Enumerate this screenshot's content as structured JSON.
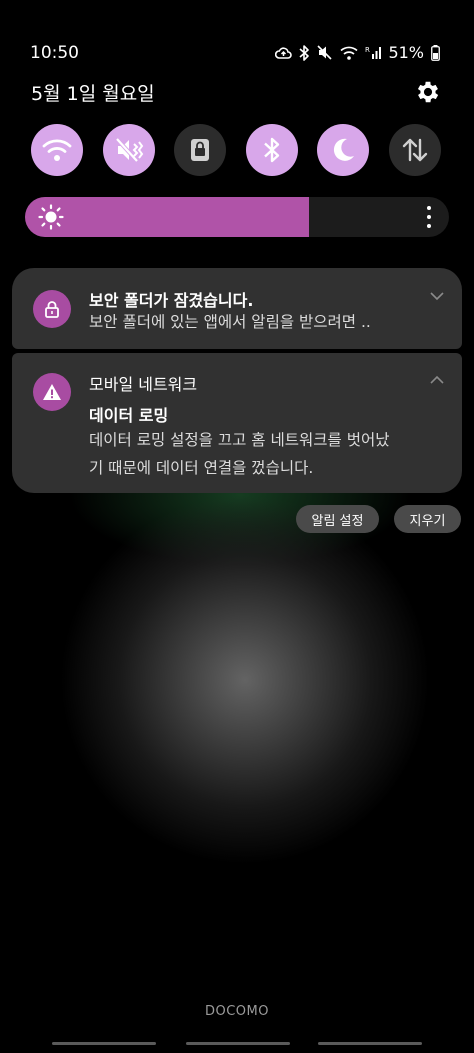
{
  "status_bar": {
    "time": "10:50",
    "battery": "51%",
    "icons": [
      "cloud-upload-icon",
      "bluetooth-icon",
      "mute-icon",
      "wifi-icon",
      "roaming-signal-icon",
      "battery-icon"
    ]
  },
  "header": {
    "date": "5월 1일 월요일",
    "settings_icon": "gear-icon"
  },
  "quick_settings": [
    {
      "name": "wifi",
      "icon": "wifi-icon",
      "state": "on"
    },
    {
      "name": "mute",
      "icon": "mute-vibrate-icon",
      "state": "on"
    },
    {
      "name": "secure-folder",
      "icon": "lock-icon",
      "state": "off"
    },
    {
      "name": "bluetooth",
      "icon": "bluetooth-icon",
      "state": "on"
    },
    {
      "name": "dark-mode",
      "icon": "moon-icon",
      "state": "on"
    },
    {
      "name": "mobile-data",
      "icon": "data-arrows-icon",
      "state": "off"
    }
  ],
  "brightness": {
    "level": 0.67,
    "icon": "sun-icon"
  },
  "notifications": {
    "secure_folder": {
      "title": "보안 폴더가 잠겼습니다.",
      "text": "보안 폴더에 있는 앱에서 알림을 받으려면 .."
    },
    "mobile_network": {
      "app_name": "모바일 네트워크",
      "title": "데이터 로밍",
      "text_line1": "데이터 로밍 설정을 끄고 홈 네트워크를 벗어났",
      "text_line2": "기 때문에 데이터 연결을 껐습니다."
    }
  },
  "actions": {
    "notification_settings": "알림 설정",
    "clear": "지우기"
  },
  "carrier": "DOCOMO",
  "colors": {
    "accent_on": "#d8a7ea",
    "brightness_fill": "#b053a8",
    "app_icon": "#a84ca2",
    "card_bg": "#313131"
  }
}
